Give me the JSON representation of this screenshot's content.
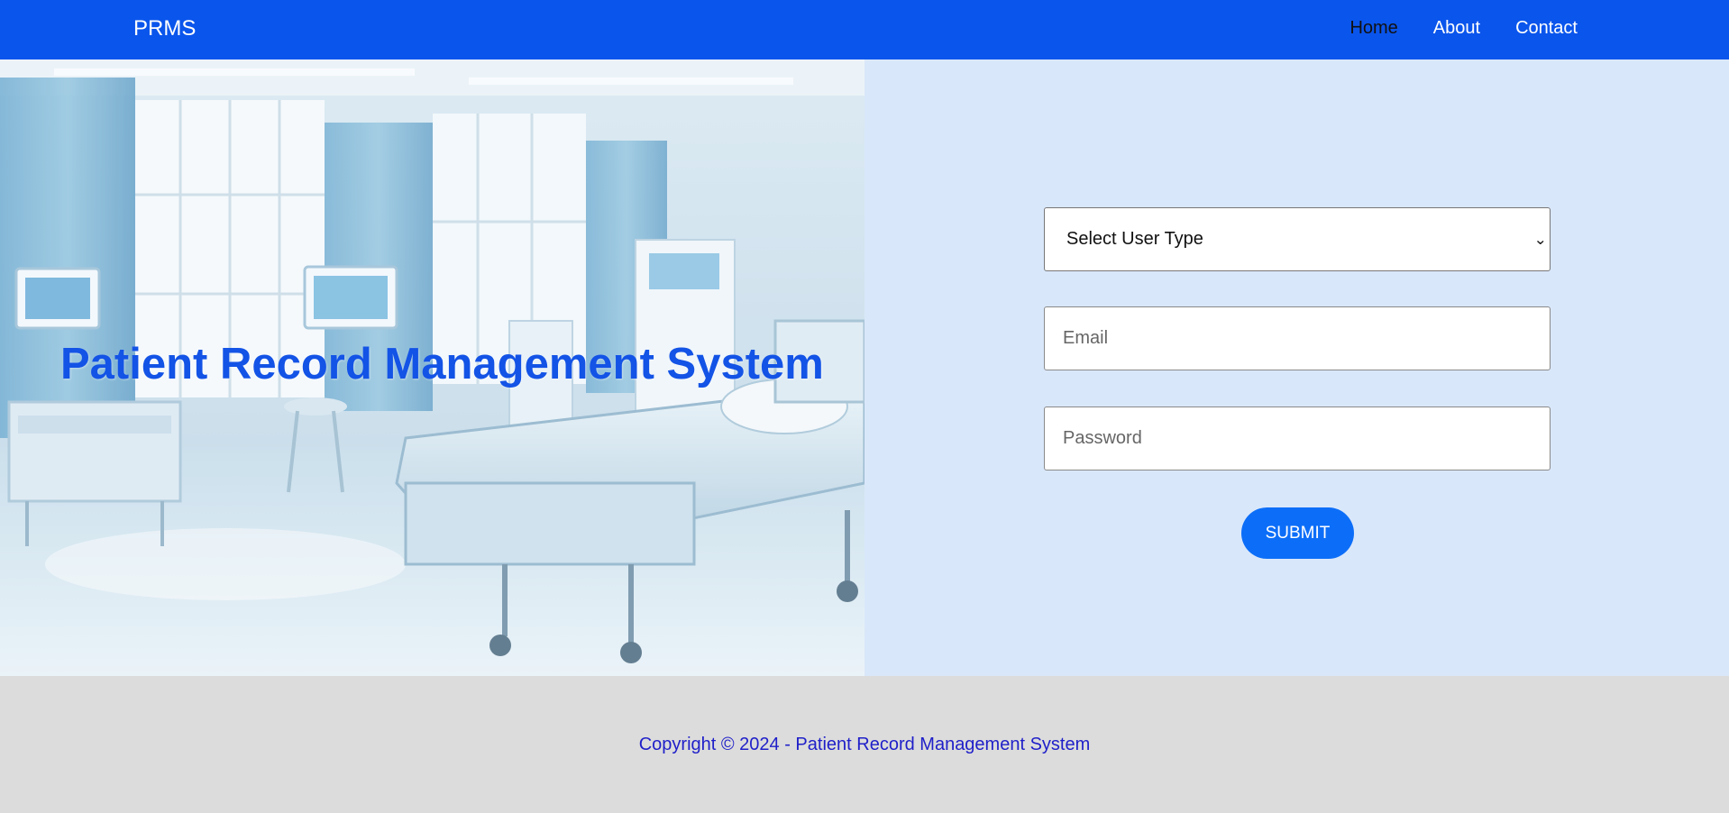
{
  "navbar": {
    "brand": "PRMS",
    "links": [
      "Home",
      "About",
      "Contact"
    ],
    "active": "Home",
    "background": "#0a55ec"
  },
  "hero": {
    "title": "Patient Record Management System",
    "image": "hospital-room-photo",
    "title_color": "#1353e6"
  },
  "login_form": {
    "user_type_select": {
      "selected": "Select User Type"
    },
    "email": {
      "placeholder": "Email",
      "value": ""
    },
    "password": {
      "placeholder": "Password",
      "value": ""
    },
    "submit_label": "SUBMIT",
    "panel_background": "#d9e7fa",
    "button_color": "#0c6ef8"
  },
  "footer": {
    "copyright": "Copyright © 2024 - Patient Record Management System"
  }
}
